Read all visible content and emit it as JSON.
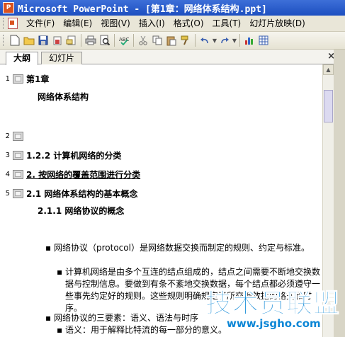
{
  "window": {
    "title": "Microsoft PowerPoint - [第1章：网络体系结构.ppt]"
  },
  "menu": [
    {
      "label": "文件(F)"
    },
    {
      "label": "编辑(E)"
    },
    {
      "label": "视图(V)"
    },
    {
      "label": "插入(I)"
    },
    {
      "label": "格式(O)"
    },
    {
      "label": "工具(T)"
    },
    {
      "label": "幻灯片放映(D)"
    }
  ],
  "toolbar": {
    "icons": [
      "new-icon",
      "open-icon",
      "save-icon",
      "permission-icon",
      "email-icon",
      "print-icon",
      "print-preview-icon",
      "spelling-icon",
      "cut-icon",
      "copy-icon",
      "paste-icon",
      "format-painter-icon",
      "undo-icon",
      "redo-icon",
      "chart-icon",
      "table-icon"
    ]
  },
  "pane": {
    "tabs": [
      "大纲",
      "幻灯片"
    ],
    "close": "×"
  },
  "slides": [
    {
      "num": "1",
      "title": "第1章",
      "subtitle": "网络体系结构"
    },
    {
      "num": "2",
      "title": ""
    },
    {
      "num": "3",
      "title": "1.2.2 计算机网络的分类"
    },
    {
      "num": "4",
      "title": "2. 按网络的覆盖范围进行分类"
    },
    {
      "num": "5",
      "title": "2.1  网络体系结构的基本概念",
      "subtitle": "2.1.1  网络协议的概念"
    }
  ],
  "bullets": [
    {
      "level": 1,
      "text": "网络协议（protocol）是网络数据交换而制定的规则、约定与标准。"
    },
    {
      "level": 2,
      "text": "计算机网络是由多个互连的结点组成的，结点之间需要不断地交换数据与控制信息。要做到有条不紊地交换数据，每个结点都必须遵守一些事先约定好的规则。这些规则明确规定了所交换数据的格式和时序。"
    },
    {
      "level": 1,
      "text": "网络协议的三要素：语义、语法与时序"
    },
    {
      "level": 2,
      "text": "语义：用于解释比特流的每一部分的意义。"
    }
  ],
  "watermark": {
    "main": "技术员联盟",
    "url": "www.jsgho.com"
  },
  "colors": {
    "titlebar": "#2a5bcc",
    "watermark": "#0b86d6",
    "menubar": "#e9e6d8"
  }
}
